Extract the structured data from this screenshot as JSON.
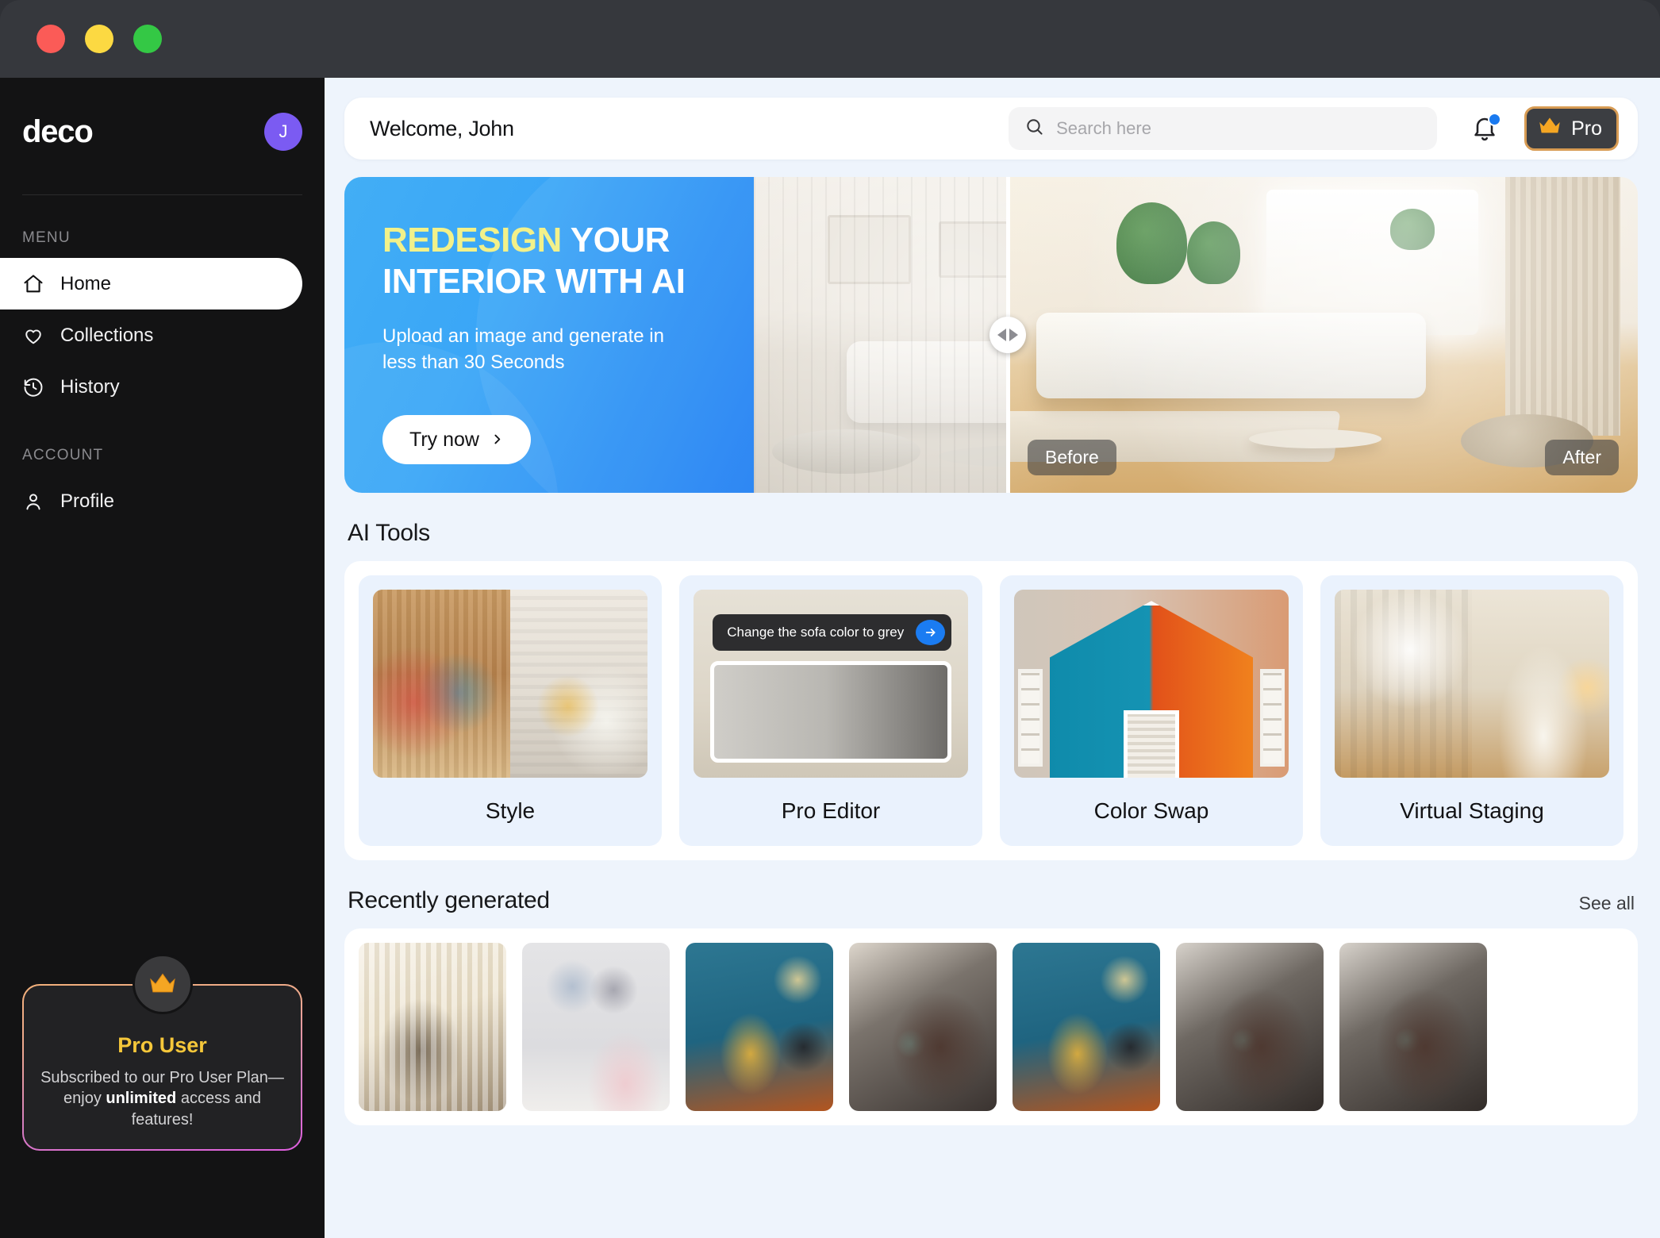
{
  "window": {
    "traffic_lights": [
      "close",
      "minimize",
      "maximize"
    ]
  },
  "sidebar": {
    "logo": "deco",
    "avatar_initial": "J",
    "menu_label": "MENU",
    "menu_items": [
      {
        "label": "Home",
        "icon": "home-icon",
        "active": true
      },
      {
        "label": "Collections",
        "icon": "heart-icon",
        "active": false
      },
      {
        "label": "History",
        "icon": "history-icon",
        "active": false
      }
    ],
    "account_label": "ACCOUNT",
    "account_items": [
      {
        "label": "Profile",
        "icon": "user-icon",
        "active": false
      }
    ],
    "pro_card": {
      "icon": "crown-icon",
      "title": "Pro User",
      "desc_part1": "Subscribed to our Pro User Plan—enjoy ",
      "desc_bold": "unlimited",
      "desc_part2": " access and features!"
    }
  },
  "header": {
    "welcome": "Welcome, John",
    "search": {
      "placeholder": "Search here",
      "value": "",
      "icon": "search-icon"
    },
    "notification": {
      "icon": "bell-icon",
      "has_unread": true,
      "dot_color": "#1a7af0"
    },
    "pro_button": {
      "label": "Pro",
      "icon": "crown-icon",
      "border_color": "#d79b53"
    }
  },
  "hero": {
    "title_highlight": "REDESIGN",
    "title_rest": " YOUR INTERIOR WITH AI",
    "subtitle": "Upload an image and generate in less than 30 Seconds",
    "cta_label": "Try now",
    "cta_icon": "chevron-right-icon",
    "before_label": "Before",
    "after_label": "After",
    "slider_icon": "left-right-arrows-icon",
    "accent_color": "#2f96f5",
    "highlight_color": "#f2f18a"
  },
  "ai_tools": {
    "section_title": "AI Tools",
    "cards": [
      {
        "label": "Style",
        "art": "style"
      },
      {
        "label": "Pro Editor",
        "art": "pro-editor",
        "prompt": "Change the sofa color to grey",
        "prompt_icon": "arrow-right-circle-icon"
      },
      {
        "label": "Color Swap",
        "art": "color-swap"
      },
      {
        "label": "Virtual Staging",
        "art": "virtual-staging"
      }
    ]
  },
  "recently_generated": {
    "section_title": "Recently generated",
    "see_all_label": "See all",
    "items": [
      {
        "art": "rc1"
      },
      {
        "art": "rc2"
      },
      {
        "art": "rc3"
      },
      {
        "art": "rc4"
      },
      {
        "art": "rc5"
      },
      {
        "art": "rc6"
      },
      {
        "art": "rc7"
      }
    ]
  }
}
